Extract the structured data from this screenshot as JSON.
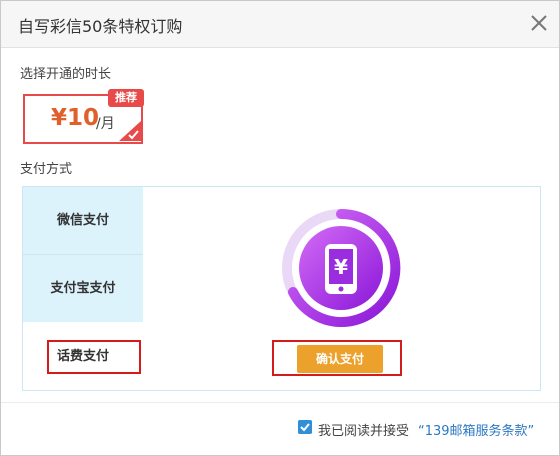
{
  "dialog": {
    "title": "自写彩信50条特权订购",
    "close_icon": "close-icon"
  },
  "duration": {
    "label": "选择开通的时长",
    "plan": {
      "price": "¥10",
      "unit": "/月",
      "badge": "推荐",
      "selected_icon": "check-icon"
    }
  },
  "payment": {
    "label": "支付方式",
    "tabs": [
      {
        "label": "微信支付"
      },
      {
        "label": "支付宝支付"
      },
      {
        "label": "话费支付"
      }
    ],
    "phone_icon": "phone-yuan-icon",
    "confirm_label": "确认支付"
  },
  "footer": {
    "agree_checked": true,
    "agree_text": "我已阅读并接受",
    "terms_link": "“139邮箱服务条款”"
  },
  "colors": {
    "accent_red": "#e84a4a",
    "price_orange": "#e0602c",
    "confirm_orange": "#eba12b",
    "tab_blue": "#dcf3fc",
    "ring_purple": "#b02fe8",
    "link_blue": "#2b78c4"
  }
}
